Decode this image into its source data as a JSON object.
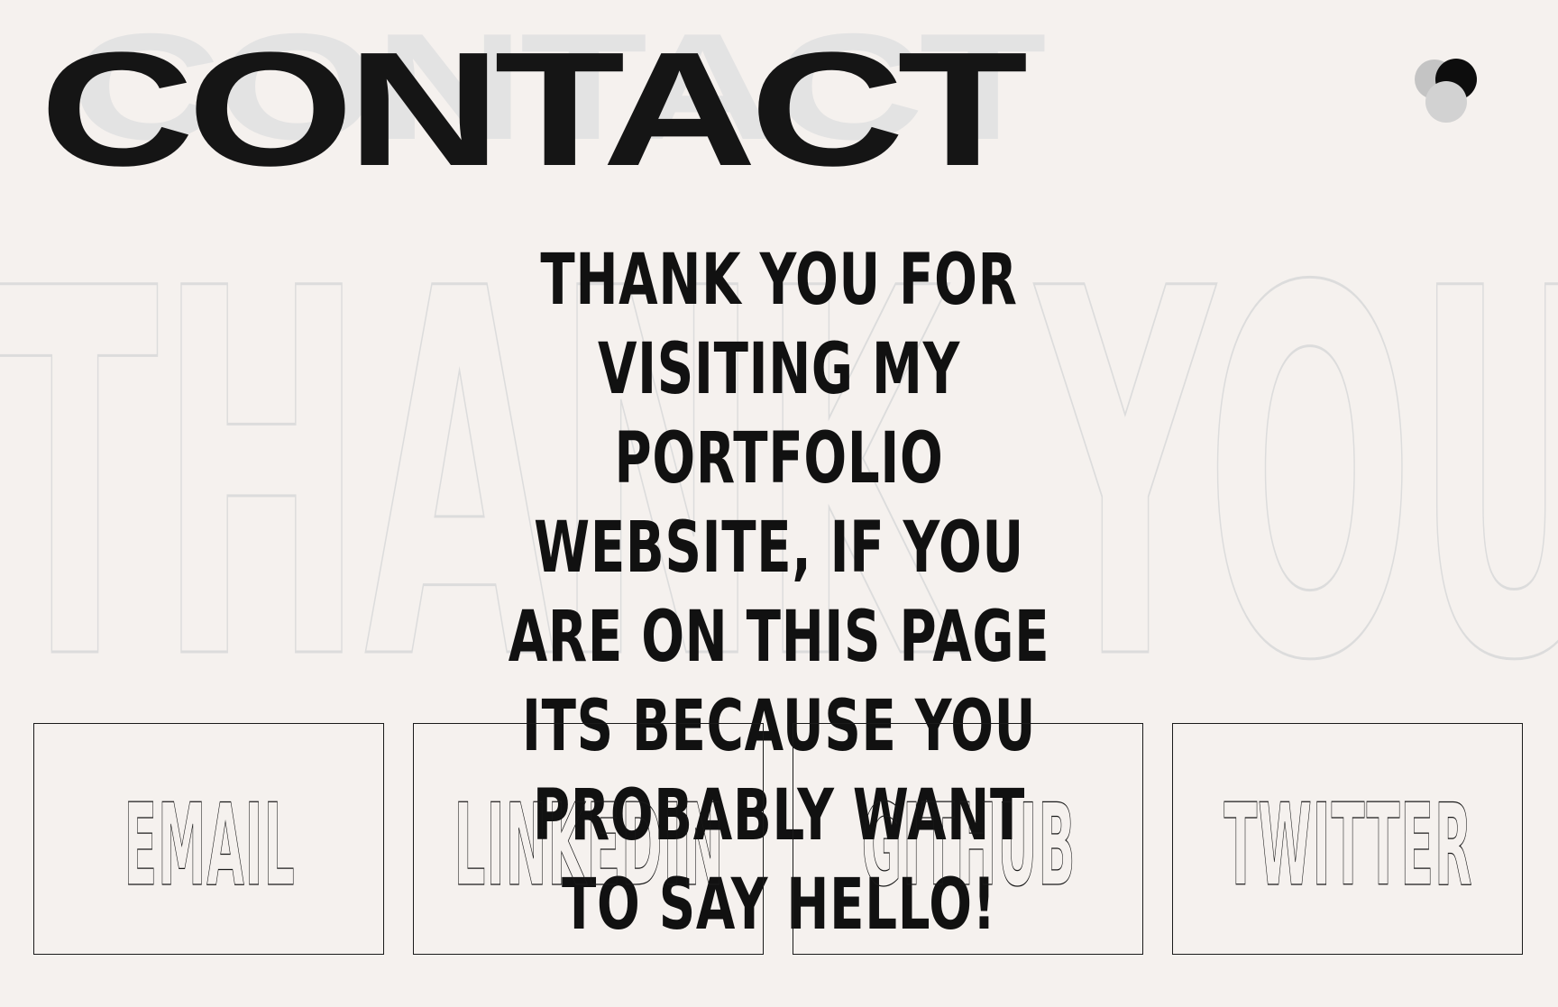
{
  "header": {
    "title": "CONTACT",
    "ghost_title": "CONTACT"
  },
  "background_word": "THANK YOU",
  "message": "THANK YOU FOR VISITING MY PORTFOLIO WEBSITE, IF YOU ARE ON THIS PAGE ITS BECAUSE YOU PROBABLY WANT TO SAY HELLO!",
  "links": [
    {
      "label": "EMAIL"
    },
    {
      "label": "LINKEDIN"
    },
    {
      "label": "GITHUB"
    },
    {
      "label": "TWITTER"
    }
  ],
  "colors": {
    "background": "#f5f1ee",
    "text": "#111111",
    "ghost": "#e3e3e3",
    "outline": "#dcdcdc"
  }
}
